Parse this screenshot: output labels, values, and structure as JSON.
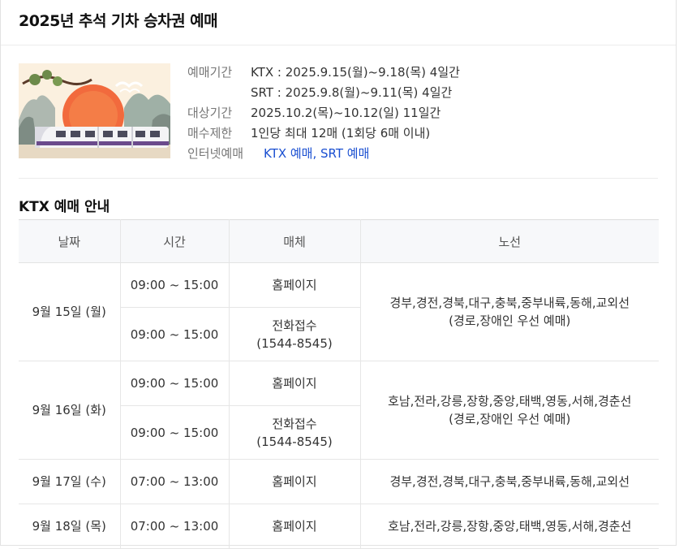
{
  "page": {
    "title": "2025년 추석 기차 승차권 예매"
  },
  "info": {
    "ktx_label": "예매기간",
    "ktx_period": "KTX : 2025.9.15(월)~9.18(목) 4일간",
    "srt_period": "SRT : 2025.9.8(월)~9.11(목) 4일간",
    "target_label": "대상기간",
    "target_period": "2025.10.2(목)~10.12(일) 11일간",
    "limit_label": "매수제한",
    "limit_value": "1인당 최대 12매 (1회당 6매 이내)",
    "online_label": "인터넷예매",
    "online_link": "KTX 예매, SRT 예매"
  },
  "section": {
    "title": "KTX 예매 안내"
  },
  "table": {
    "headers": [
      "날짜",
      "시간",
      "매체",
      "노선"
    ],
    "rows": [
      {
        "date": "9월 15일 (월)",
        "slots": [
          {
            "time": "09:00 ~ 15:00",
            "medium": "홈페이지"
          },
          {
            "time": "09:00 ~ 15:00",
            "medium": "전화접수",
            "phone": "(1544-8545)"
          }
        ],
        "route": "경부,경전,경북,대구,충북,중부내륙,동해,교외선",
        "route_note": "(경로,장애인 우선 예매)"
      },
      {
        "date": "9월 16일 (화)",
        "slots": [
          {
            "time": "09:00 ~ 15:00",
            "medium": "홈페이지"
          },
          {
            "time": "09:00 ~ 15:00",
            "medium": "전화접수",
            "phone": "(1544-8545)"
          }
        ],
        "route": "호남,전라,강릉,장항,중앙,태백,영동,서해,경춘선",
        "route_note": "(경로,장애인 우선 예매)"
      },
      {
        "date": "9월 17일 (수)",
        "slots": [
          {
            "time": "07:00 ~ 13:00",
            "medium": "홈페이지"
          }
        ],
        "route": "경부,경전,경북,대구,충북,중부내륙,동해,교외선"
      },
      {
        "date": "9월 18일 (목)",
        "slots": [
          {
            "time": "07:00 ~ 13:00",
            "medium": "홈페이지"
          }
        ],
        "route": "호남,전라,강릉,장항,중앙,태백,영동,서해,경춘선"
      }
    ]
  },
  "colors": {
    "link": "#1a4fd1",
    "header_bg": "#f7f8fa",
    "sun": "#f2603a",
    "train_stripe": "#6b4b8c"
  }
}
